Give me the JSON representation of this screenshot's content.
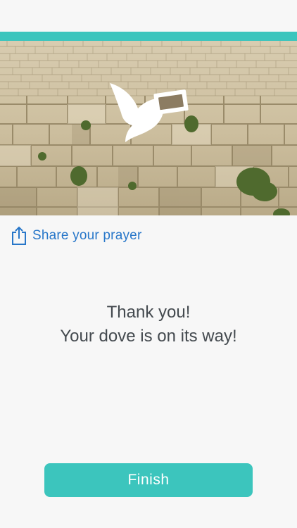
{
  "colors": {
    "accent": "#3cc5bd",
    "link": "#2877c9",
    "text": "#444a4f",
    "background": "#f7f7f7"
  },
  "hero": {
    "image": "western-wall-with-dove",
    "icon": "dove-with-note-icon"
  },
  "share": {
    "icon": "share-icon",
    "label": "Share your prayer"
  },
  "message": {
    "line1": "Thank you!",
    "line2": "Your dove is on its way!"
  },
  "actions": {
    "finish_label": "Finish"
  }
}
